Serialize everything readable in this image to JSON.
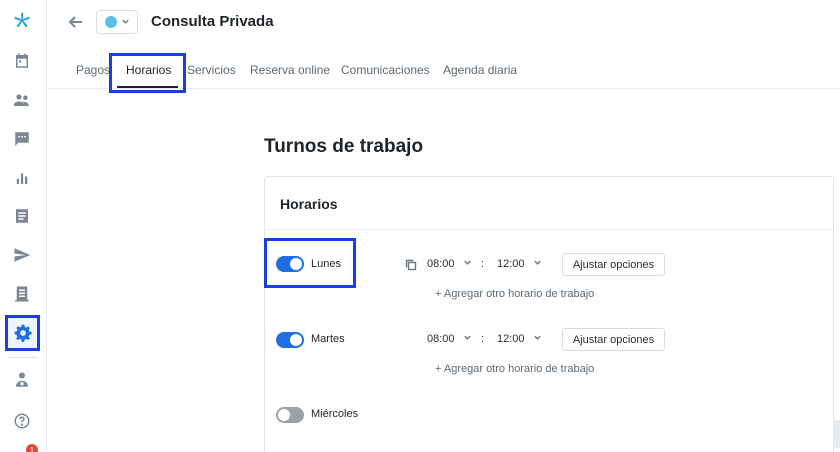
{
  "sidebar": {
    "items": [
      {
        "name": "logo",
        "icon": "logo-icon"
      },
      {
        "name": "calendar",
        "icon": "calendar-icon"
      },
      {
        "name": "patients",
        "icon": "people-icon"
      },
      {
        "name": "messages",
        "icon": "chat-icon"
      },
      {
        "name": "reports",
        "icon": "bar-chart-icon"
      },
      {
        "name": "documents",
        "icon": "document-icon"
      },
      {
        "name": "campaigns",
        "icon": "send-icon"
      },
      {
        "name": "records",
        "icon": "notebook-icon"
      },
      {
        "name": "settings",
        "icon": "gear-icon",
        "active": true
      },
      {
        "name": "profile",
        "icon": "doctor-icon"
      },
      {
        "name": "help",
        "icon": "help-icon"
      }
    ],
    "notification_count": "1"
  },
  "header": {
    "title": "Consulta Privada",
    "color_dot": "#5bbde8"
  },
  "tabs": [
    {
      "label": "Pagos"
    },
    {
      "label": "Horarios",
      "active": true
    },
    {
      "label": "Servicios"
    },
    {
      "label": "Reserva online"
    },
    {
      "label": "Comunicaciones"
    },
    {
      "label": "Agenda diaria"
    }
  ],
  "main": {
    "section_title": "Turnos de trabajo",
    "card_title": "Horarios",
    "days": [
      {
        "label": "Lunes",
        "enabled": true,
        "start": "08:00",
        "end": "12:00",
        "adjust_label": "Ajustar opciones",
        "add_label": "+ Agregar otro horario de trabajo"
      },
      {
        "label": "Martes",
        "enabled": true,
        "start": "08:00",
        "end": "12:00",
        "adjust_label": "Ajustar opciones",
        "add_label": "+ Agregar otro horario de trabajo"
      },
      {
        "label": "Miércoles",
        "enabled": false
      }
    ],
    "time_separator": ":"
  },
  "colors": {
    "accent": "#1f6fe0",
    "logo": "#1aa3e8",
    "highlight": "#1a3fe0"
  }
}
